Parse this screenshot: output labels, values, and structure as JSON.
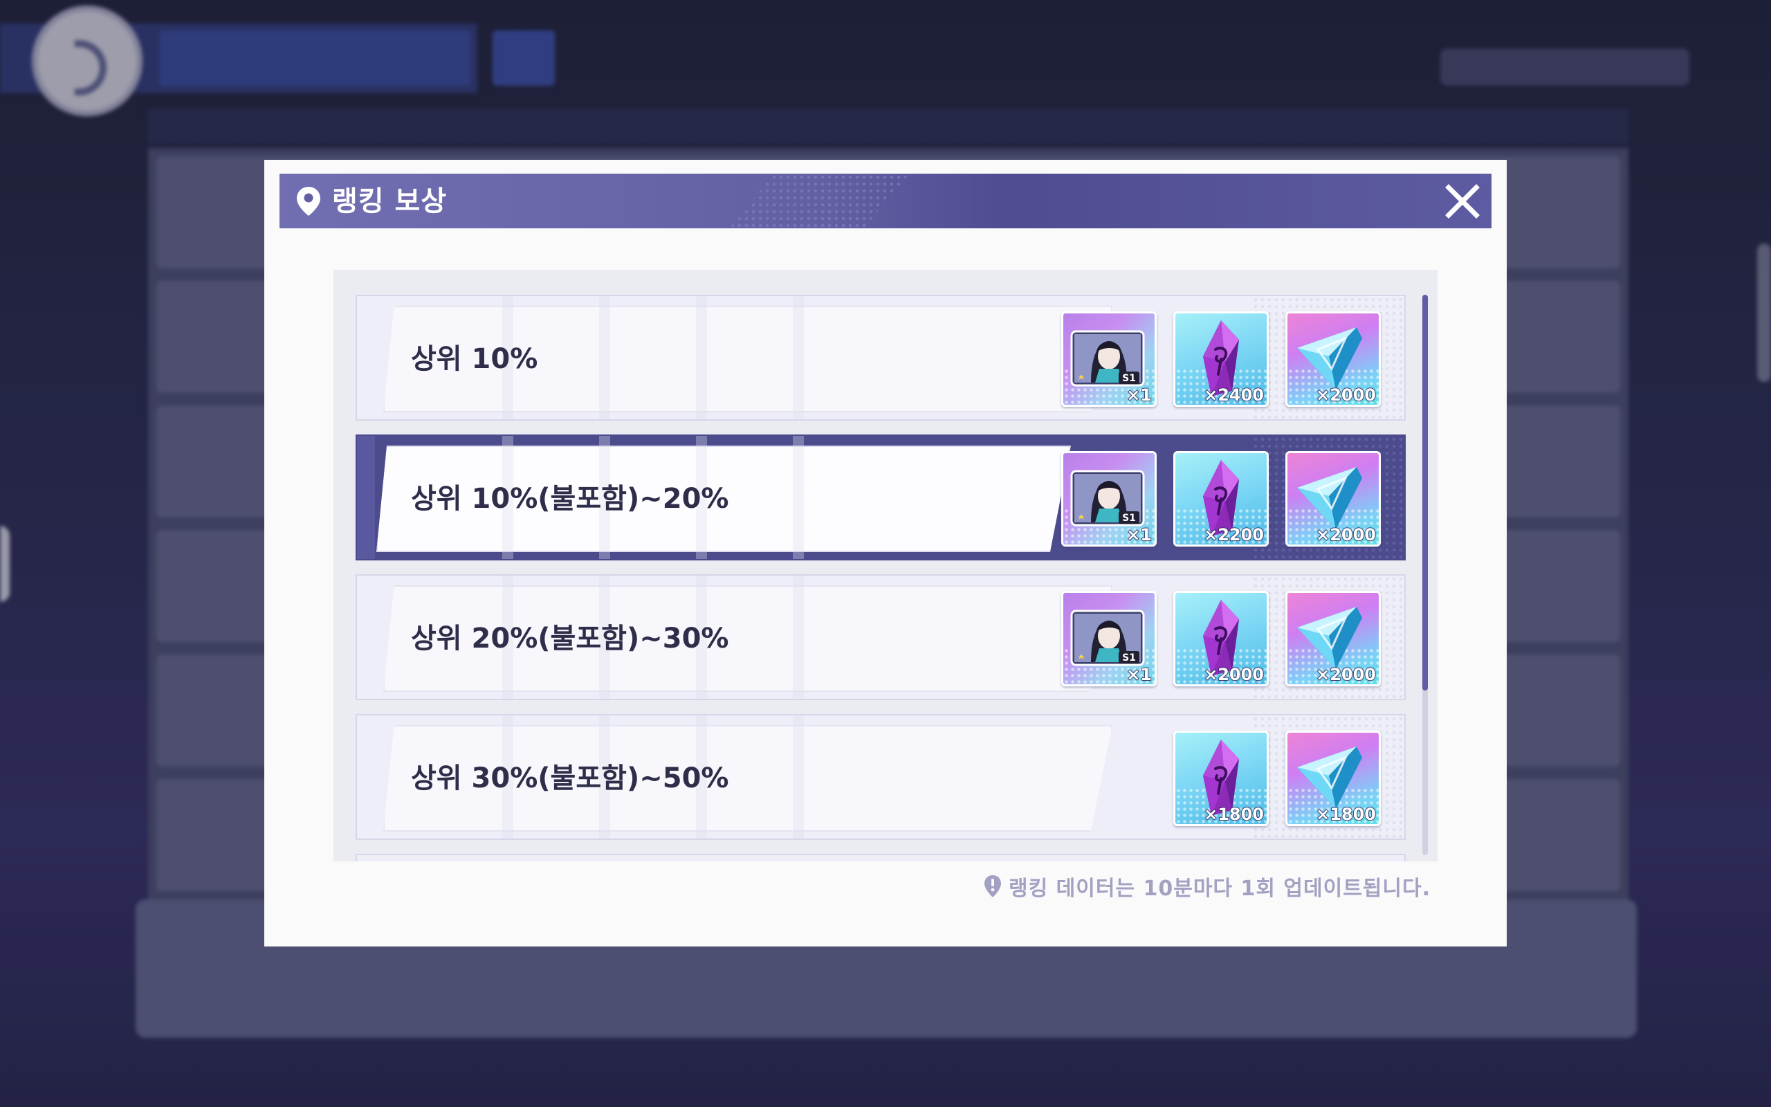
{
  "modal": {
    "title": "랭킹 보상",
    "notice": "랭킹 데이터는 10분마다 1회 업데이트됩니다."
  },
  "colors": {
    "header": "#625fa3",
    "selected_row": "#4c4b8c",
    "scrollbar": "#5f5ea4",
    "notice_text": "#a2a1c2"
  },
  "tiers": [
    {
      "label": "상위 10%",
      "selected": false,
      "rewards": [
        {
          "type": "character-card",
          "icon": "character-card-icon",
          "qty": "×1"
        },
        {
          "type": "purple-gem",
          "icon": "purple-gem-icon",
          "qty": "×2400"
        },
        {
          "type": "blue-crystal",
          "icon": "blue-crystal-icon",
          "qty": "×2000"
        }
      ]
    },
    {
      "label": "상위 10%(불포함)~20%",
      "selected": true,
      "rewards": [
        {
          "type": "character-card",
          "icon": "character-card-icon",
          "qty": "×1"
        },
        {
          "type": "purple-gem",
          "icon": "purple-gem-icon",
          "qty": "×2200"
        },
        {
          "type": "blue-crystal",
          "icon": "blue-crystal-icon",
          "qty": "×2000"
        }
      ]
    },
    {
      "label": "상위 20%(불포함)~30%",
      "selected": false,
      "rewards": [
        {
          "type": "character-card",
          "icon": "character-card-icon",
          "qty": "×1"
        },
        {
          "type": "purple-gem",
          "icon": "purple-gem-icon",
          "qty": "×2000"
        },
        {
          "type": "blue-crystal",
          "icon": "blue-crystal-icon",
          "qty": "×2000"
        }
      ]
    },
    {
      "label": "상위 30%(불포함)~50%",
      "selected": false,
      "rewards": [
        {
          "type": "purple-gem",
          "icon": "purple-gem-icon",
          "qty": "×1800"
        },
        {
          "type": "blue-crystal",
          "icon": "blue-crystal-icon",
          "qty": "×1800"
        }
      ]
    }
  ]
}
